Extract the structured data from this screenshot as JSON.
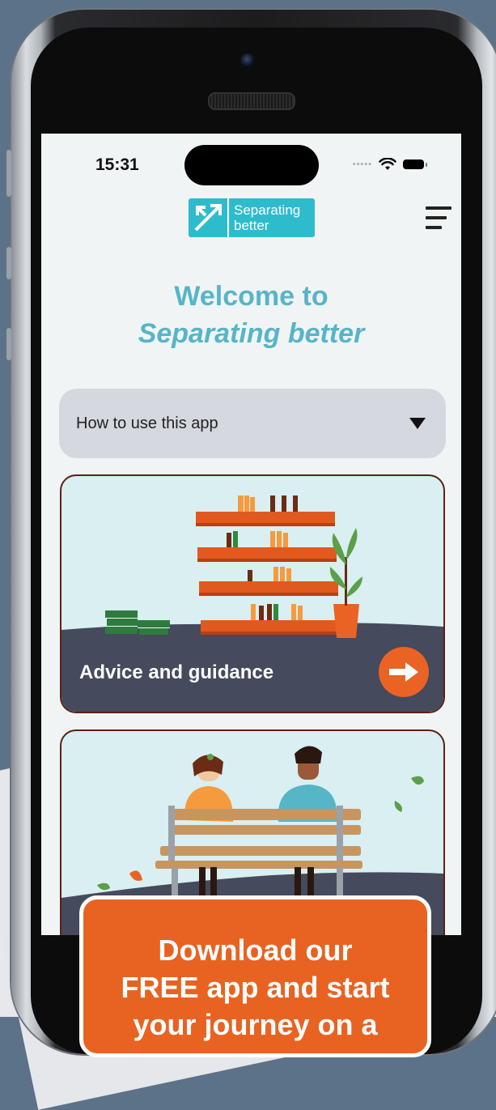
{
  "status_bar": {
    "time": "15:31"
  },
  "header": {
    "logo_line1": "Separating",
    "logo_line2": "better"
  },
  "welcome": {
    "line1": "Welcome to",
    "line2": "Separating better"
  },
  "dropdown": {
    "label": "How to use this app"
  },
  "cards": [
    {
      "title": "Advice and guidance"
    },
    {
      "title": ""
    }
  ],
  "cta": {
    "line1": "Download our",
    "line2": "FREE app and start",
    "line3": "your journey on a"
  },
  "colors": {
    "accent_teal": "#56b5c7",
    "logo_teal": "#2dbccc",
    "accent_orange": "#ea6324",
    "card_ground": "#454a5c"
  }
}
